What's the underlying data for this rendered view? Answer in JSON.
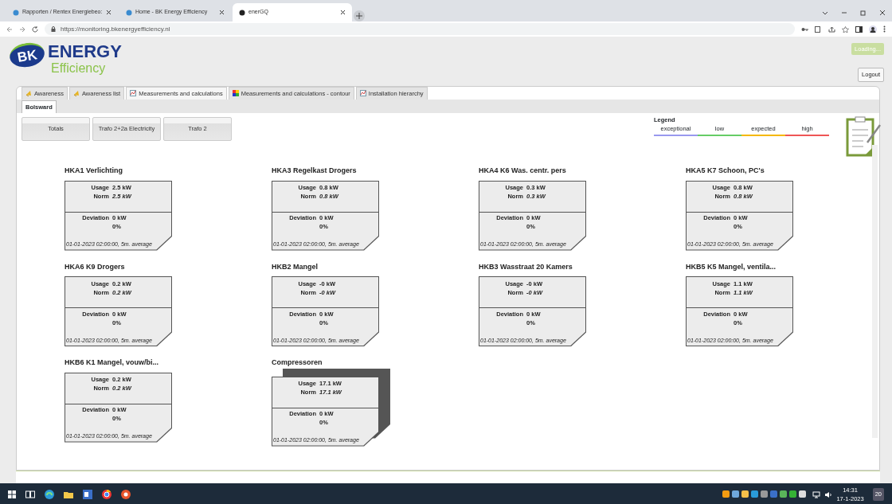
{
  "browser": {
    "tabs": [
      {
        "title": "Rapporten / Rentex Energiebeo:",
        "selected": false
      },
      {
        "title": "Home - BK Energy Efficiency",
        "selected": false
      },
      {
        "title": "enerGQ",
        "selected": true
      }
    ],
    "url": "https://monitoring.bkenergyefficiency.nl"
  },
  "header": {
    "logo": {
      "mark": "BK",
      "name": "ENERGY",
      "subtitle": "Efficiency"
    },
    "status": "Loading...",
    "logout": "Logout"
  },
  "main_tabs": [
    {
      "label": "Awareness",
      "kind": "awareness",
      "selected": false
    },
    {
      "label": "Awareness list",
      "kind": "awareness",
      "selected": false
    },
    {
      "label": "Measurements and calculations",
      "kind": "chart",
      "selected": true
    },
    {
      "label": "Measurements and calculations - contour",
      "kind": "contour",
      "selected": false
    },
    {
      "label": "Installation hierarchy",
      "kind": "chart",
      "selected": false
    }
  ],
  "location_tabs": [
    {
      "label": "Bolsward",
      "selected": true
    }
  ],
  "filter_buttons": [
    "Totals",
    "Trafo 2+2a Electricity",
    "Trafo 2"
  ],
  "legend": {
    "title": "Legend",
    "items": [
      {
        "label": "exceptional",
        "color": "#9999ee"
      },
      {
        "label": "low",
        "color": "#66cc66"
      },
      {
        "label": "expected",
        "color": "#f5b800"
      },
      {
        "label": "high",
        "color": "#ee5555"
      }
    ]
  },
  "meters": [
    {
      "title": "HKA1 Verlichting",
      "usage_label": "Usage",
      "usage": "2.5 kW",
      "norm_label": "Norm",
      "norm": "2.5 kW",
      "deviation_label": "Deviation",
      "deviation": "0 kW",
      "percent": "0%",
      "footer": "01-01-2023 02:00:00, 5m. average",
      "stacked": false
    },
    {
      "title": "HKA3 Regelkast Drogers",
      "usage_label": "Usage",
      "usage": "0.8 kW",
      "norm_label": "Norm",
      "norm": "0.8 kW",
      "deviation_label": "Deviation",
      "deviation": "0 kW",
      "percent": "0%",
      "footer": "01-01-2023 02:00:00, 5m. average",
      "stacked": false
    },
    {
      "title": "HKA4 K6 Was. centr. pers",
      "usage_label": "Usage",
      "usage": "0.3 kW",
      "norm_label": "Norm",
      "norm": "0.3 kW",
      "deviation_label": "Deviation",
      "deviation": "0 kW",
      "percent": "0%",
      "footer": "01-01-2023 02:00:00, 5m. average",
      "stacked": false
    },
    {
      "title": "HKA5 K7 Schoon, PC's",
      "usage_label": "Usage",
      "usage": "0.8 kW",
      "norm_label": "Norm",
      "norm": "0.8 kW",
      "deviation_label": "Deviation",
      "deviation": "0 kW",
      "percent": "0%",
      "footer": "01-01-2023 02:00:00, 5m. average",
      "stacked": false
    },
    {
      "title": "HKA6 K9 Drogers",
      "usage_label": "Usage",
      "usage": "0.2 kW",
      "norm_label": "Norm",
      "norm": "0.2 kW",
      "deviation_label": "Deviation",
      "deviation": "0 kW",
      "percent": "0%",
      "footer": "01-01-2023 02:00:00, 5m. average",
      "stacked": false
    },
    {
      "title": "HKB2 Mangel",
      "usage_label": "Usage",
      "usage": "-0 kW",
      "norm_label": "Norm",
      "norm": "-0 kW",
      "deviation_label": "Deviation",
      "deviation": "0 kW",
      "percent": "0%",
      "footer": "01-01-2023 02:00:00, 5m. average",
      "stacked": false
    },
    {
      "title": "HKB3 Wasstraat 20 Kamers",
      "usage_label": "Usage",
      "usage": "-0 kW",
      "norm_label": "Norm",
      "norm": "-0 kW",
      "deviation_label": "Deviation",
      "deviation": "0 kW",
      "percent": "0%",
      "footer": "01-01-2023 02:00:00, 5m. average",
      "stacked": false
    },
    {
      "title": "HKB5 K5 Mangel, ventila...",
      "usage_label": "Usage",
      "usage": "1.1 kW",
      "norm_label": "Norm",
      "norm": "1.1 kW",
      "deviation_label": "Deviation",
      "deviation": "0 kW",
      "percent": "0%",
      "footer": "01-01-2023 02:00:00, 5m. average",
      "stacked": false
    },
    {
      "title": "HKB6 K1 Mangel, vouw/bi...",
      "usage_label": "Usage",
      "usage": "0.2 kW",
      "norm_label": "Norm",
      "norm": "0.2 kW",
      "deviation_label": "Deviation",
      "deviation": "0 kW",
      "percent": "0%",
      "footer": "01-01-2023 02:00:00, 5m. average",
      "stacked": false
    },
    {
      "title": "Compressoren",
      "usage_label": "Usage",
      "usage": "17.1 kW",
      "norm_label": "Norm",
      "norm": "17.1 kW",
      "deviation_label": "Deviation",
      "deviation": "0 kW",
      "percent": "0%",
      "footer": "01-01-2023 02:00:00, 5m. average",
      "stacked": true
    }
  ],
  "taskbar": {
    "time": "14:31",
    "date": "17-1-2023",
    "notifications": "20"
  }
}
